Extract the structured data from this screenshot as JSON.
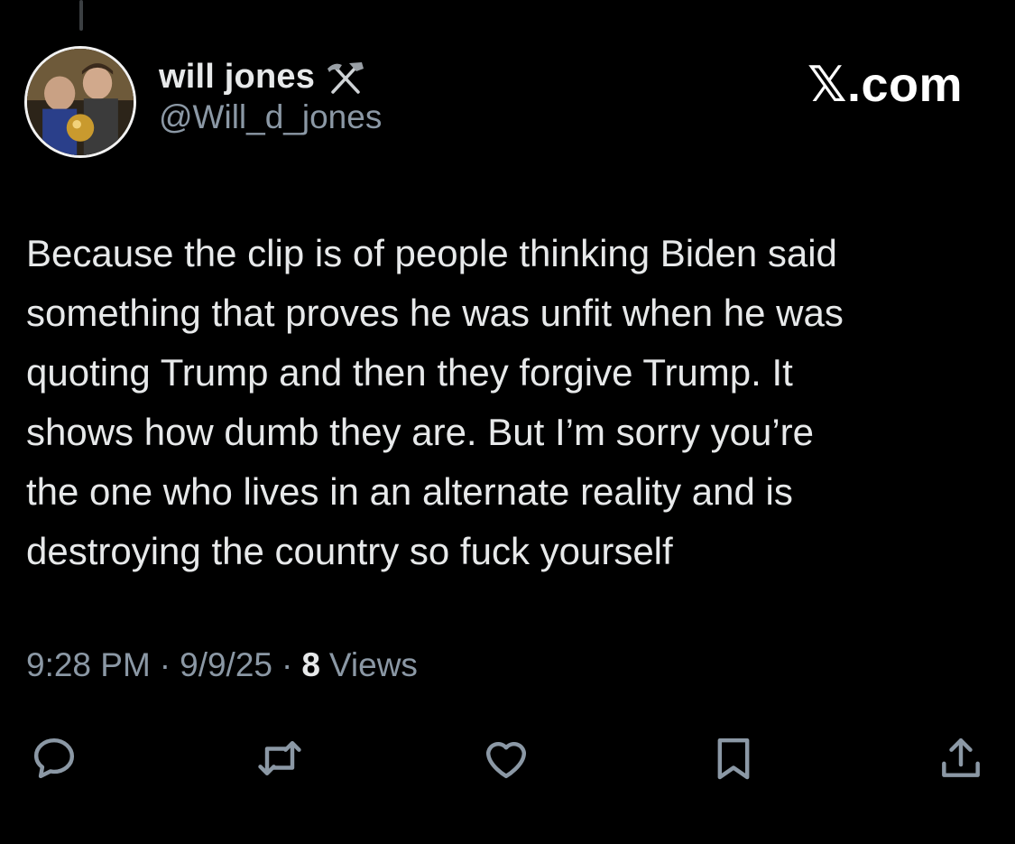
{
  "author": {
    "display_name": "will jones",
    "handle": "@Will_d_jones",
    "badge_icon": "hammer-pick-icon",
    "avatar": "avatar-image"
  },
  "brand": {
    "label": "𝕏.com"
  },
  "tweet": {
    "text": "Because the clip is of people thinking Biden said\nsomething that proves he was unfit when he was\nquoting Trump and then they forgive Trump. It\nshows how dumb they are. But I’m sorry you’re\nthe one who lives in an alternate reality and is\ndestroying the country so fuck yourself"
  },
  "meta": {
    "time": "9:28 PM",
    "separator": "·",
    "date": "9/9/25",
    "views_count": "8",
    "views_label": "Views"
  },
  "actions": [
    {
      "name": "reply",
      "icon": "reply-icon"
    },
    {
      "name": "repost",
      "icon": "repost-icon"
    },
    {
      "name": "like",
      "icon": "heart-icon"
    },
    {
      "name": "bookmark",
      "icon": "bookmark-icon"
    },
    {
      "name": "share",
      "icon": "share-icon"
    }
  ],
  "colors": {
    "background": "#000000",
    "text": "#e7e9ea",
    "secondary_text": "#8b98a5",
    "icon": "#8b98a5"
  }
}
